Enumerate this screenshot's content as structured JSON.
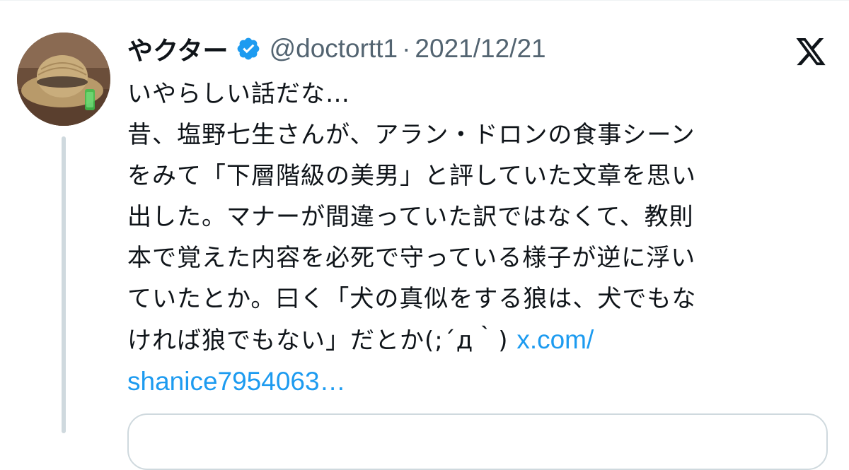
{
  "tweet": {
    "display_name": "やクター",
    "verified_icon": "verified-badge-icon",
    "handle": "@doctortt1",
    "separator": "·",
    "date": "2021/12/21",
    "platform_icon": "x-logo-icon",
    "avatar": "avatar-straw-hat",
    "body_lines": [
      "いやらしい話だな…",
      "昔、塩野七生さんが、アラン・ドロンの食事シーン",
      "をみて「下層階級の美男」と評していた文章を思い",
      "出した。マナーが間違っていた訳ではなくて、教則",
      "本で覚えた内容を必死で守っている様子が逆に浮い",
      "ていたとか。曰く「犬の真似をする狼は、犬でもな",
      "ければ狼でもない」だとか(;´д｀)"
    ],
    "link_part1": "x.com/",
    "link_part2": "shanice7954063…"
  },
  "colors": {
    "text": "#0f1419",
    "secondary": "#536471",
    "link": "#1d9bf0",
    "verified": "#1d9bf0",
    "thread_line": "#cfd9de"
  }
}
